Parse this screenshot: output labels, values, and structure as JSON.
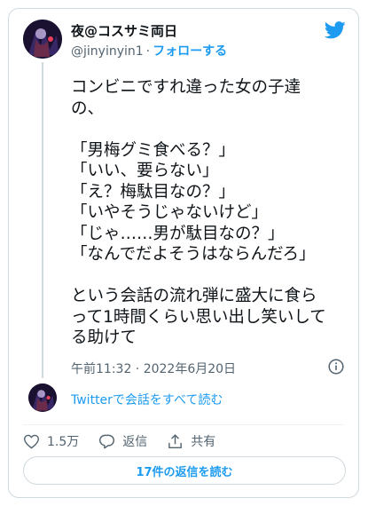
{
  "tweet": {
    "author_name": "夜@コスサミ両日",
    "handle": "@jinyinyin1",
    "separator": "·",
    "follow_label": "フォローする",
    "text": "コンビニですれ違った女の子達\nの、\n\n「男梅グミ食べる？」\n「いい、要らない」\n「え？梅駄目なの？」\n「いやそうじゃないけど」\n「じゃ……男が駄目なの？」\n「なんでだよそうはならんだろ」\n\nという会話の流れ弾に盛大に食ら\nって1時間くらい思い出し笑いして\nる助けて",
    "timestamp": "午前11:32 · 2022年6月20日"
  },
  "conversation": {
    "read_label": "Twitterで会話をすべて読む"
  },
  "actions": {
    "likes_count": "1.5万",
    "reply_label": "返信",
    "share_label": "共有"
  },
  "replies_button": {
    "label": "17件の返信を読む"
  },
  "colors": {
    "accent": "#1d9bf0",
    "text": "#0f1419",
    "secondary": "#536471",
    "border": "#cfd9de"
  }
}
